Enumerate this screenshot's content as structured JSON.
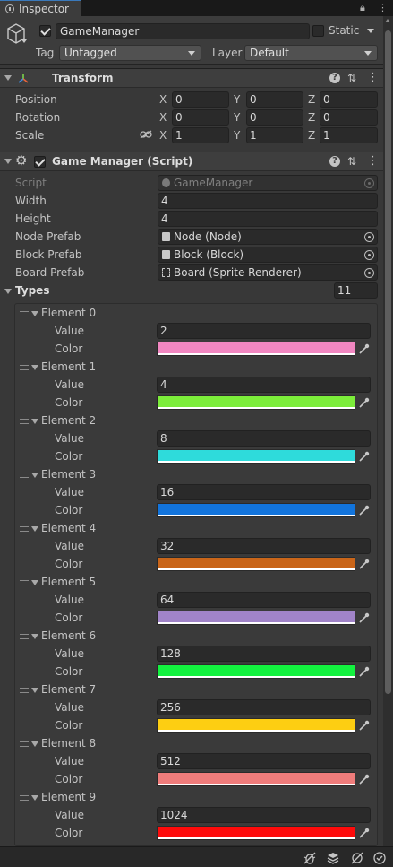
{
  "tab": {
    "title": "Inspector"
  },
  "header": {
    "object_name": "GameManager",
    "active": true,
    "static_label": "Static",
    "tag_label": "Tag",
    "tag_value": "Untagged",
    "layer_label": "Layer",
    "layer_value": "Default"
  },
  "transform": {
    "title": "Transform",
    "position": {
      "label": "Position",
      "x": "0",
      "y": "0",
      "z": "0"
    },
    "rotation": {
      "label": "Rotation",
      "x": "0",
      "y": "0",
      "z": "0"
    },
    "scale": {
      "label": "Scale",
      "x": "1",
      "y": "1",
      "z": "1"
    },
    "axis_x": "X",
    "axis_y": "Y",
    "axis_z": "Z"
  },
  "script_component": {
    "title": "Game Manager (Script)",
    "enabled": true,
    "fields": {
      "script": {
        "label": "Script",
        "value": "GameManager"
      },
      "width": {
        "label": "Width",
        "value": "4"
      },
      "height": {
        "label": "Height",
        "value": "4"
      },
      "node_prefab": {
        "label": "Node Prefab",
        "value": "Node (Node)"
      },
      "block_prefab": {
        "label": "Block Prefab",
        "value": "Block (Block)"
      },
      "board_prefab": {
        "label": "Board Prefab",
        "value": "Board (Sprite Renderer)"
      }
    },
    "types": {
      "label": "Types",
      "count": "11",
      "value_label": "Value",
      "color_label": "Color",
      "elements": [
        {
          "label": "Element 0",
          "value": "2",
          "color": "#f187c1"
        },
        {
          "label": "Element 1",
          "value": "4",
          "color": "#7ced3a"
        },
        {
          "label": "Element 2",
          "value": "8",
          "color": "#2edbdb"
        },
        {
          "label": "Element 3",
          "value": "16",
          "color": "#1274dc"
        },
        {
          "label": "Element 4",
          "value": "32",
          "color": "#c96519"
        },
        {
          "label": "Element 5",
          "value": "64",
          "color": "#a184c9"
        },
        {
          "label": "Element 6",
          "value": "128",
          "color": "#13f13f"
        },
        {
          "label": "Element 7",
          "value": "256",
          "color": "#fdce12"
        },
        {
          "label": "Element 8",
          "value": "512",
          "color": "#ef7c7b"
        },
        {
          "label": "Element 9",
          "value": "1024",
          "color": "#fe0b0b"
        }
      ]
    }
  },
  "status_icons": [
    "debug-bug-icon",
    "layers-icon",
    "lock-off-icon",
    "checkmark-circle-icon"
  ]
}
